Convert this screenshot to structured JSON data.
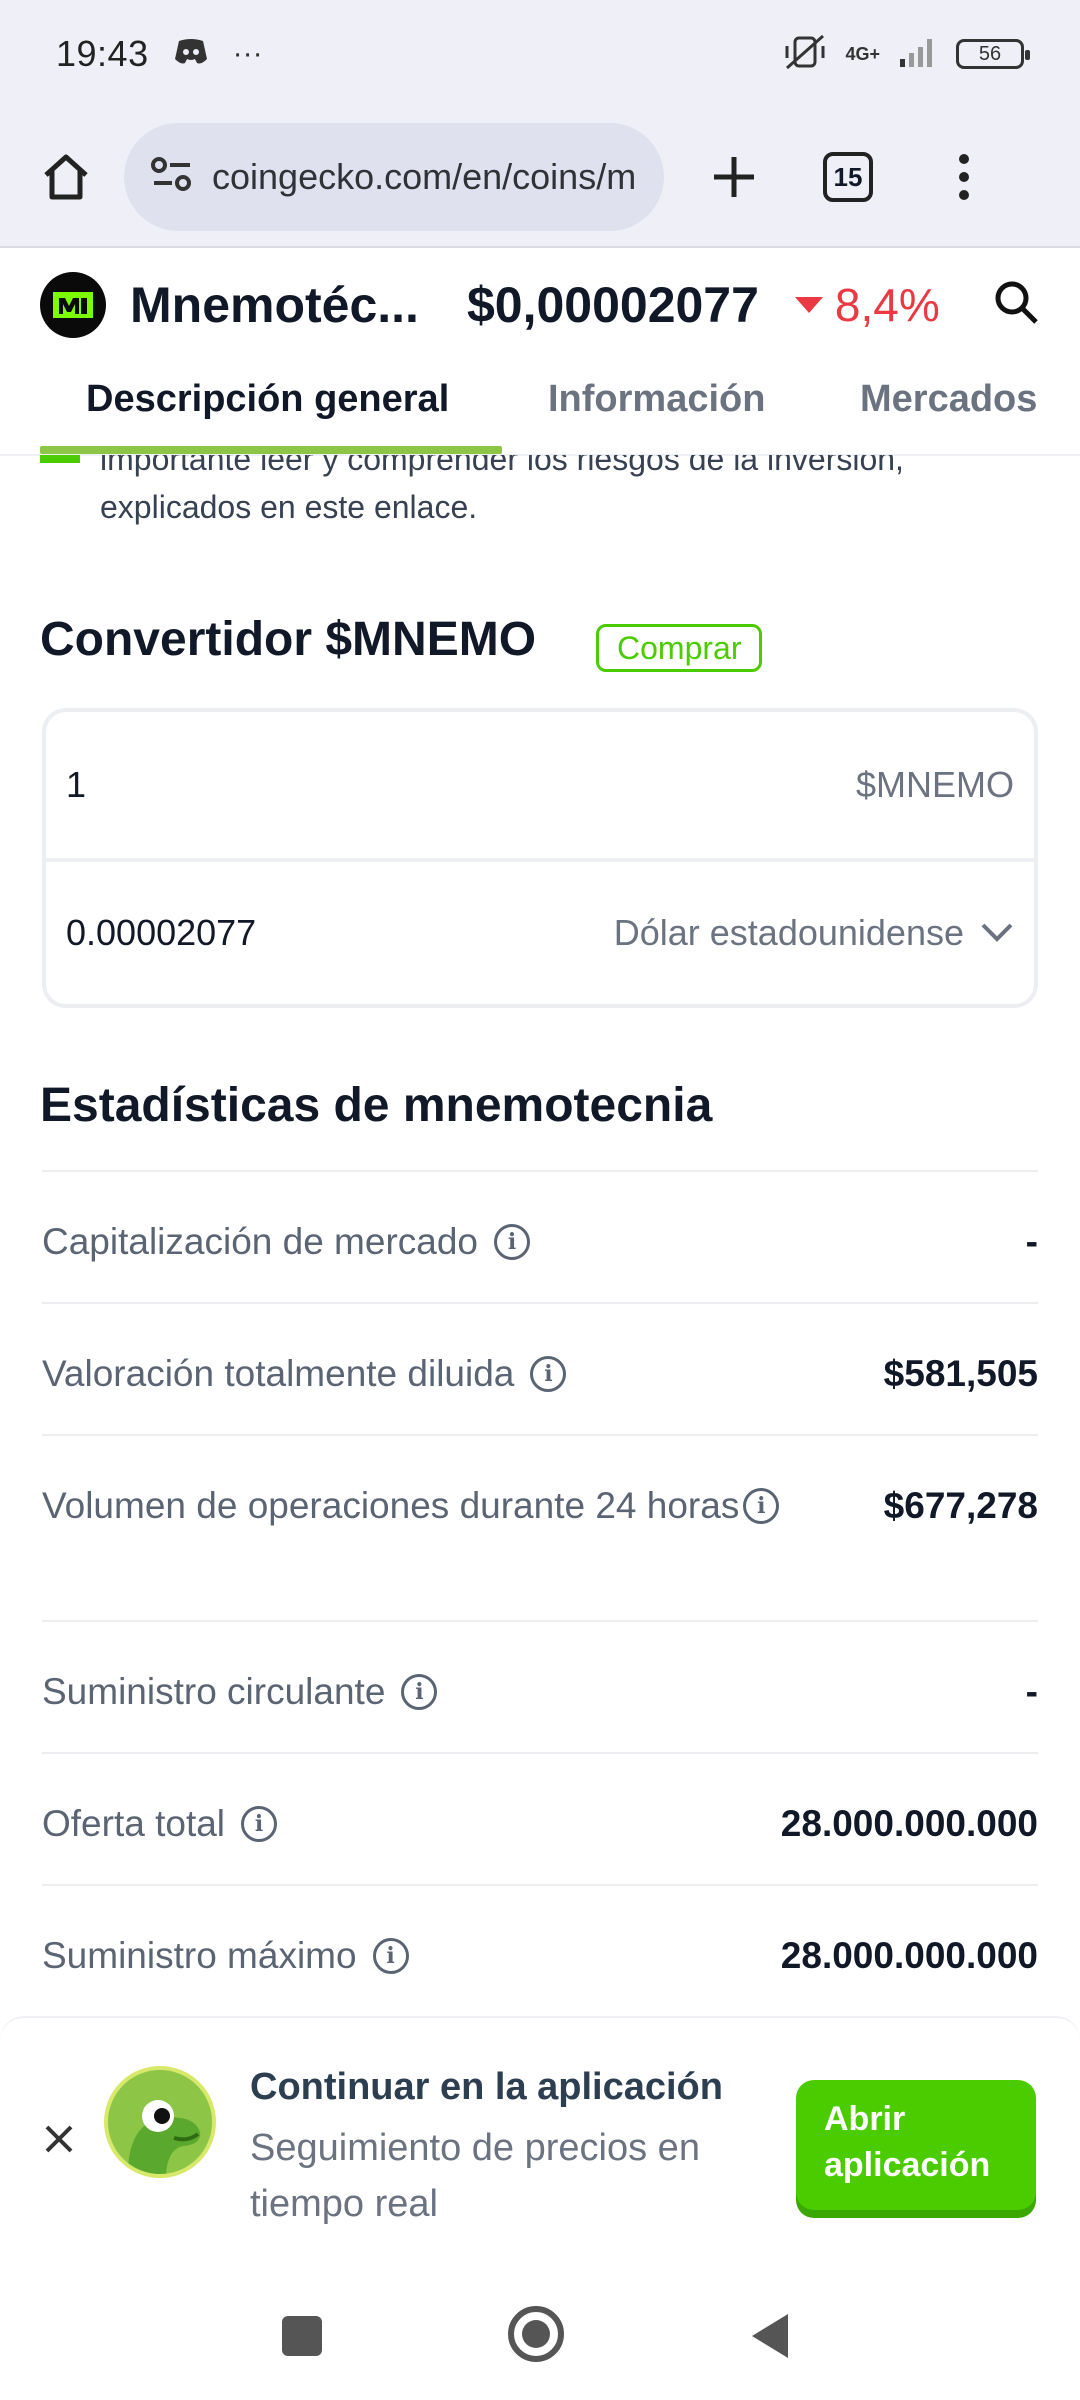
{
  "status_bar": {
    "time": "19:43",
    "more": "···",
    "network": "4G+",
    "battery": "56"
  },
  "browser": {
    "url": "coingecko.com/en/coins/mnemotecnia",
    "tabs_count": "15"
  },
  "coin": {
    "name": "Mnemotéc...",
    "price": "$0,00002077",
    "change": "8,4%",
    "change_direction": "down",
    "change_color": "#ea3943"
  },
  "tabs": [
    {
      "label": "Descripción general",
      "active": true
    },
    {
      "label": "Información",
      "active": false
    },
    {
      "label": "Mercados",
      "active": false
    }
  ],
  "disclaimer": {
    "text": "importante leer y comprender los riesgos de la inversión, explicados en este enlace."
  },
  "converter": {
    "title": "Convertidor $MNEMO",
    "buy_label": "Comprar",
    "from_value": "1",
    "from_unit": "$MNEMO",
    "to_value": "0.00002077",
    "to_unit": "Dólar estadounidense"
  },
  "stats": {
    "title": "Estadísticas de mnemotecnia",
    "rows": [
      {
        "label": "Capitalización de mercado",
        "value": "-"
      },
      {
        "label": "Valoración totalmente diluida",
        "value": "$581,505"
      },
      {
        "label": "Volumen de operaciones durante 24 horas",
        "value": "$677,278"
      },
      {
        "label": "Suministro circulante",
        "value": "-"
      },
      {
        "label": "Oferta total",
        "value": "28.000.000.000"
      },
      {
        "label": "Suministro máximo",
        "value": "28.000.000.000"
      }
    ]
  },
  "app_banner": {
    "title": "Continuar en la aplicación",
    "subtitle": "Seguimiento de precios en tiempo real",
    "button": "Abrir aplicación"
  },
  "colors": {
    "brand_green": "#4bcc00",
    "tab_underline": "#8dc647",
    "negative": "#ea3943"
  }
}
